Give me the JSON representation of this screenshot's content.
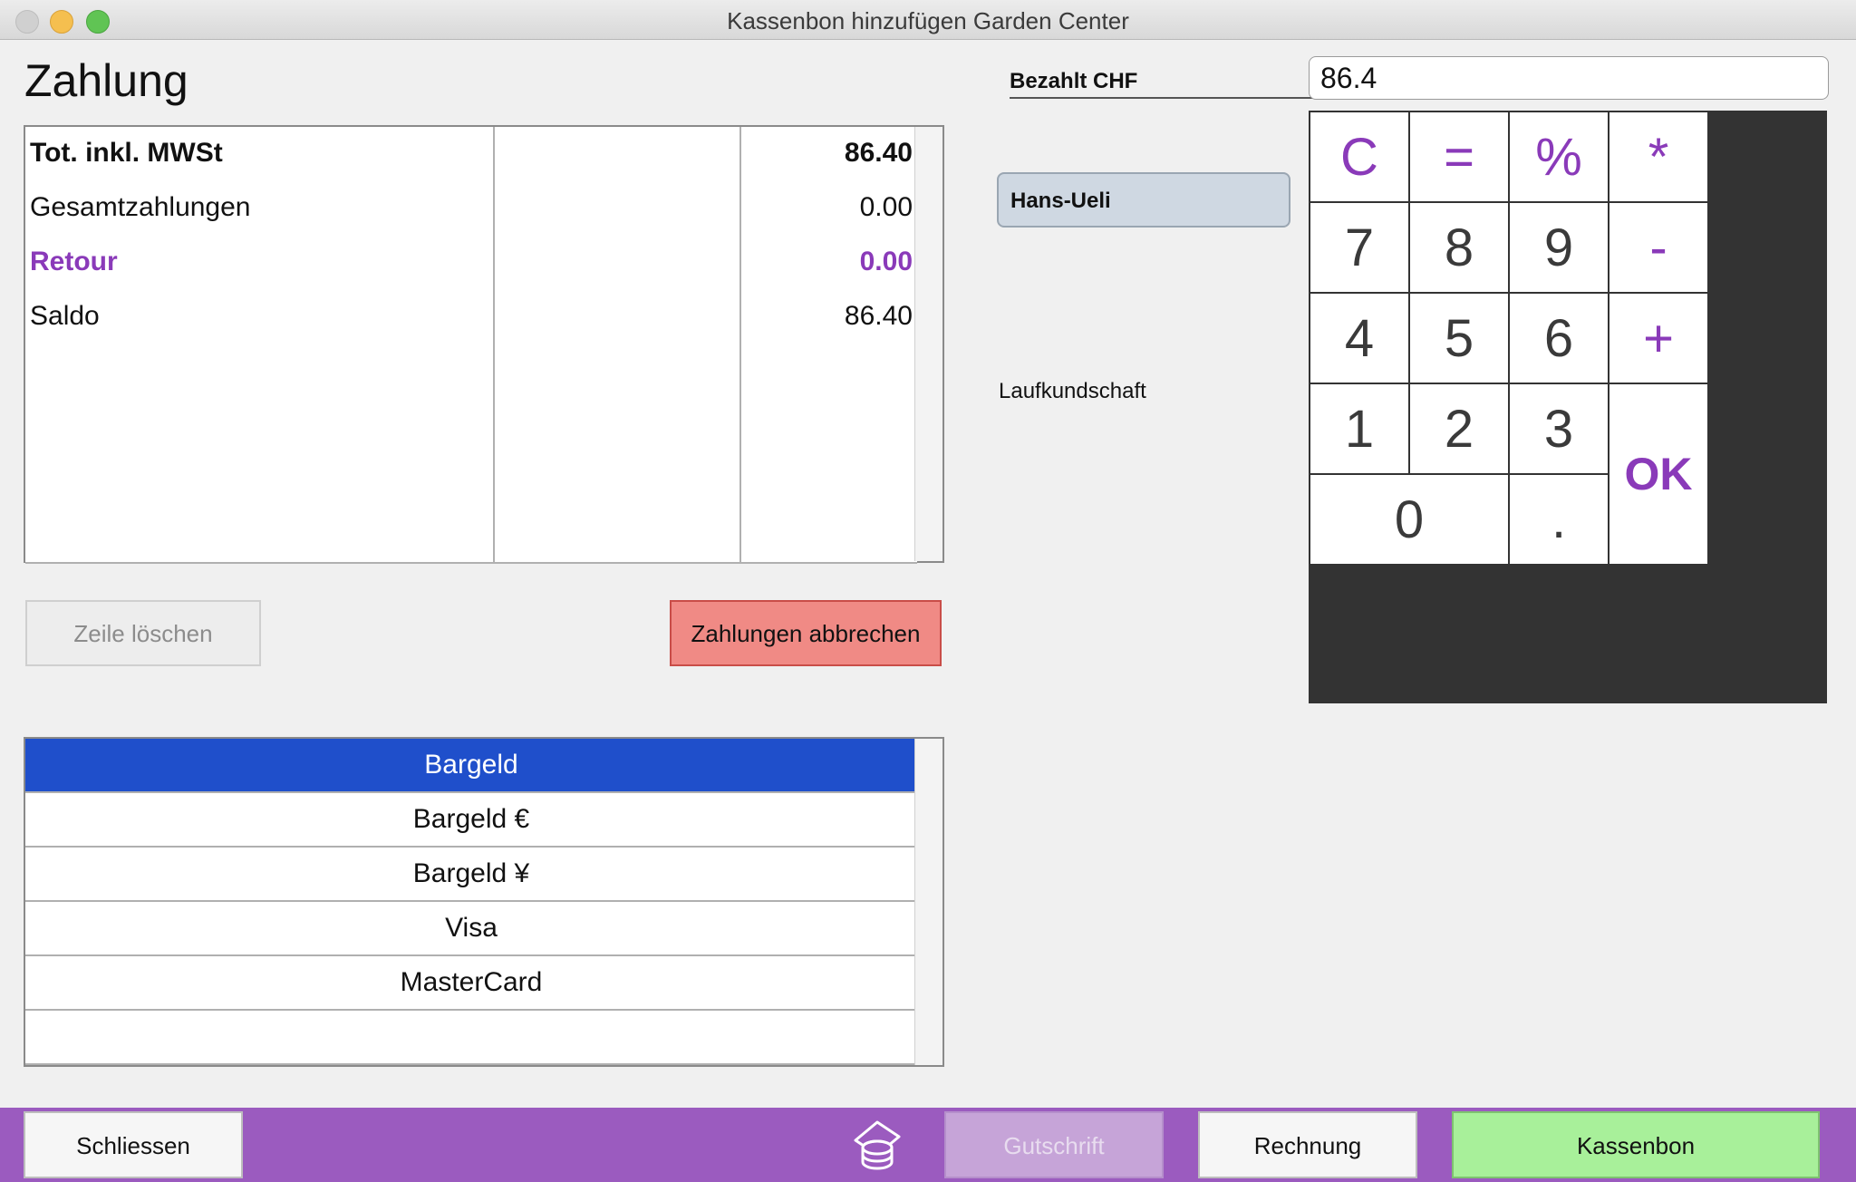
{
  "window": {
    "title": "Kassenbon hinzufügen Garden Center"
  },
  "page": {
    "heading": "Zahlung"
  },
  "summary": {
    "rows": [
      {
        "label": "Tot. inkl. MWSt",
        "middle": "",
        "value": "86.40",
        "style": "bold"
      },
      {
        "label": "Gesamtzahlungen",
        "middle": "",
        "value": "0.00",
        "style": "normal"
      },
      {
        "label": "Retour",
        "middle": "",
        "value": "0.00",
        "style": "purple"
      },
      {
        "label": "Saldo",
        "middle": "",
        "value": "86.40",
        "style": "normal"
      },
      {
        "label": "",
        "middle": "",
        "value": ""
      },
      {
        "label": "",
        "middle": "",
        "value": ""
      },
      {
        "label": "",
        "middle": "",
        "value": ""
      },
      {
        "label": "",
        "middle": "",
        "value": ""
      }
    ]
  },
  "actions": {
    "delete_row": "Zeile löschen",
    "cancel_payments": "Zahlungen abbrechen"
  },
  "payment_methods": {
    "selected_index": 0,
    "items": [
      "Bargeld",
      "Bargeld €",
      "Bargeld ¥",
      "Visa",
      "MasterCard",
      ""
    ]
  },
  "payment": {
    "paid_label": "Bezahlt CHF",
    "paid_value": "86.4"
  },
  "user": {
    "name": "Hans-Ueli"
  },
  "customer": {
    "name": "Laufkundschaft"
  },
  "keypad": {
    "row1": [
      "C",
      "=",
      "%",
      "*"
    ],
    "row2": [
      "7",
      "8",
      "9",
      "-"
    ],
    "row3": [
      "4",
      "5",
      "6",
      "+"
    ],
    "row4": [
      "1",
      "2",
      "3"
    ],
    "row5": [
      "0",
      "."
    ],
    "ok": "OK"
  },
  "bottombar": {
    "close": "Schliessen",
    "credit": "Gutschrift",
    "invoice": "Rechnung",
    "receipt": "Kassenbon",
    "drawer_icon": "cash-drawer-icon"
  },
  "colors": {
    "accent_purple": "#8a3ab9",
    "bottombar": "#9b5bbf",
    "selected_row": "#1f4fcb",
    "cancel_button": "#f08a85",
    "receipt_button": "#a8f09a"
  }
}
